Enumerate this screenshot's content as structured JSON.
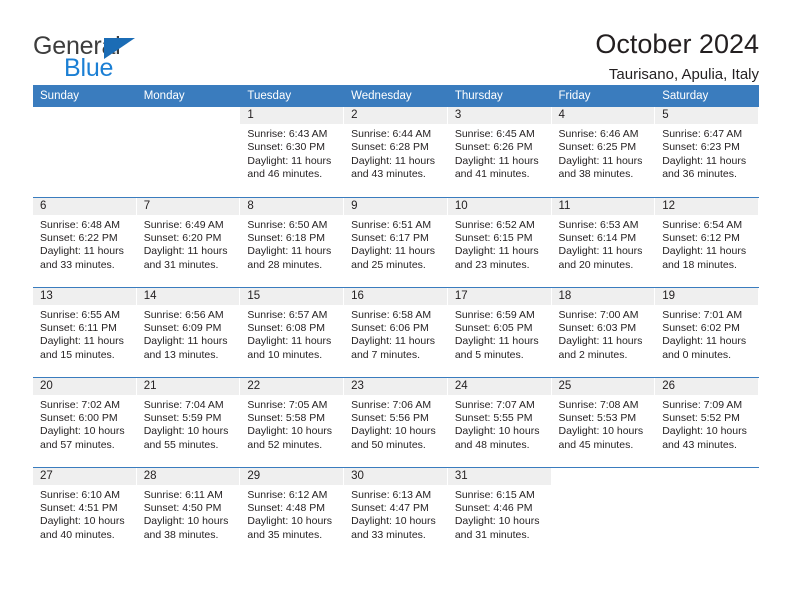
{
  "logo": {
    "word1": "General",
    "word2": "Blue",
    "triangle_color": "#1b6cb5",
    "word2_color": "#1b7fd4"
  },
  "header": {
    "title": "October 2024",
    "location": "Taurisano, Apulia, Italy"
  },
  "calendar": {
    "accent_color": "#3a7cbe",
    "daynum_band_color": "#efefef",
    "weekday_headers": [
      "Sunday",
      "Monday",
      "Tuesday",
      "Wednesday",
      "Thursday",
      "Friday",
      "Saturday"
    ],
    "labels": {
      "sunrise": "Sunrise:",
      "sunset": "Sunset:",
      "daylight": "Daylight:"
    },
    "weeks": [
      [
        {
          "day": "",
          "lines": [],
          "blank": true
        },
        {
          "day": "",
          "lines": [],
          "blank": true
        },
        {
          "day": "1",
          "lines": [
            "Sunrise: 6:43 AM",
            "Sunset: 6:30 PM",
            "Daylight: 11 hours",
            "and 46 minutes."
          ]
        },
        {
          "day": "2",
          "lines": [
            "Sunrise: 6:44 AM",
            "Sunset: 6:28 PM",
            "Daylight: 11 hours",
            "and 43 minutes."
          ]
        },
        {
          "day": "3",
          "lines": [
            "Sunrise: 6:45 AM",
            "Sunset: 6:26 PM",
            "Daylight: 11 hours",
            "and 41 minutes."
          ]
        },
        {
          "day": "4",
          "lines": [
            "Sunrise: 6:46 AM",
            "Sunset: 6:25 PM",
            "Daylight: 11 hours",
            "and 38 minutes."
          ]
        },
        {
          "day": "5",
          "lines": [
            "Sunrise: 6:47 AM",
            "Sunset: 6:23 PM",
            "Daylight: 11 hours",
            "and 36 minutes."
          ]
        }
      ],
      [
        {
          "day": "6",
          "lines": [
            "Sunrise: 6:48 AM",
            "Sunset: 6:22 PM",
            "Daylight: 11 hours",
            "and 33 minutes."
          ]
        },
        {
          "day": "7",
          "lines": [
            "Sunrise: 6:49 AM",
            "Sunset: 6:20 PM",
            "Daylight: 11 hours",
            "and 31 minutes."
          ]
        },
        {
          "day": "8",
          "lines": [
            "Sunrise: 6:50 AM",
            "Sunset: 6:18 PM",
            "Daylight: 11 hours",
            "and 28 minutes."
          ]
        },
        {
          "day": "9",
          "lines": [
            "Sunrise: 6:51 AM",
            "Sunset: 6:17 PM",
            "Daylight: 11 hours",
            "and 25 minutes."
          ]
        },
        {
          "day": "10",
          "lines": [
            "Sunrise: 6:52 AM",
            "Sunset: 6:15 PM",
            "Daylight: 11 hours",
            "and 23 minutes."
          ]
        },
        {
          "day": "11",
          "lines": [
            "Sunrise: 6:53 AM",
            "Sunset: 6:14 PM",
            "Daylight: 11 hours",
            "and 20 minutes."
          ]
        },
        {
          "day": "12",
          "lines": [
            "Sunrise: 6:54 AM",
            "Sunset: 6:12 PM",
            "Daylight: 11 hours",
            "and 18 minutes."
          ]
        }
      ],
      [
        {
          "day": "13",
          "lines": [
            "Sunrise: 6:55 AM",
            "Sunset: 6:11 PM",
            "Daylight: 11 hours",
            "and 15 minutes."
          ]
        },
        {
          "day": "14",
          "lines": [
            "Sunrise: 6:56 AM",
            "Sunset: 6:09 PM",
            "Daylight: 11 hours",
            "and 13 minutes."
          ]
        },
        {
          "day": "15",
          "lines": [
            "Sunrise: 6:57 AM",
            "Sunset: 6:08 PM",
            "Daylight: 11 hours",
            "and 10 minutes."
          ]
        },
        {
          "day": "16",
          "lines": [
            "Sunrise: 6:58 AM",
            "Sunset: 6:06 PM",
            "Daylight: 11 hours",
            "and 7 minutes."
          ]
        },
        {
          "day": "17",
          "lines": [
            "Sunrise: 6:59 AM",
            "Sunset: 6:05 PM",
            "Daylight: 11 hours",
            "and 5 minutes."
          ]
        },
        {
          "day": "18",
          "lines": [
            "Sunrise: 7:00 AM",
            "Sunset: 6:03 PM",
            "Daylight: 11 hours",
            "and 2 minutes."
          ]
        },
        {
          "day": "19",
          "lines": [
            "Sunrise: 7:01 AM",
            "Sunset: 6:02 PM",
            "Daylight: 11 hours",
            "and 0 minutes."
          ]
        }
      ],
      [
        {
          "day": "20",
          "lines": [
            "Sunrise: 7:02 AM",
            "Sunset: 6:00 PM",
            "Daylight: 10 hours",
            "and 57 minutes."
          ]
        },
        {
          "day": "21",
          "lines": [
            "Sunrise: 7:04 AM",
            "Sunset: 5:59 PM",
            "Daylight: 10 hours",
            "and 55 minutes."
          ]
        },
        {
          "day": "22",
          "lines": [
            "Sunrise: 7:05 AM",
            "Sunset: 5:58 PM",
            "Daylight: 10 hours",
            "and 52 minutes."
          ]
        },
        {
          "day": "23",
          "lines": [
            "Sunrise: 7:06 AM",
            "Sunset: 5:56 PM",
            "Daylight: 10 hours",
            "and 50 minutes."
          ]
        },
        {
          "day": "24",
          "lines": [
            "Sunrise: 7:07 AM",
            "Sunset: 5:55 PM",
            "Daylight: 10 hours",
            "and 48 minutes."
          ]
        },
        {
          "day": "25",
          "lines": [
            "Sunrise: 7:08 AM",
            "Sunset: 5:53 PM",
            "Daylight: 10 hours",
            "and 45 minutes."
          ]
        },
        {
          "day": "26",
          "lines": [
            "Sunrise: 7:09 AM",
            "Sunset: 5:52 PM",
            "Daylight: 10 hours",
            "and 43 minutes."
          ]
        }
      ],
      [
        {
          "day": "27",
          "lines": [
            "Sunrise: 6:10 AM",
            "Sunset: 4:51 PM",
            "Daylight: 10 hours",
            "and 40 minutes."
          ]
        },
        {
          "day": "28",
          "lines": [
            "Sunrise: 6:11 AM",
            "Sunset: 4:50 PM",
            "Daylight: 10 hours",
            "and 38 minutes."
          ]
        },
        {
          "day": "29",
          "lines": [
            "Sunrise: 6:12 AM",
            "Sunset: 4:48 PM",
            "Daylight: 10 hours",
            "and 35 minutes."
          ]
        },
        {
          "day": "30",
          "lines": [
            "Sunrise: 6:13 AM",
            "Sunset: 4:47 PM",
            "Daylight: 10 hours",
            "and 33 minutes."
          ]
        },
        {
          "day": "31",
          "lines": [
            "Sunrise: 6:15 AM",
            "Sunset: 4:46 PM",
            "Daylight: 10 hours",
            "and 31 minutes."
          ]
        },
        {
          "day": "",
          "lines": [],
          "blank": true
        },
        {
          "day": "",
          "lines": [],
          "blank": true
        }
      ]
    ]
  }
}
